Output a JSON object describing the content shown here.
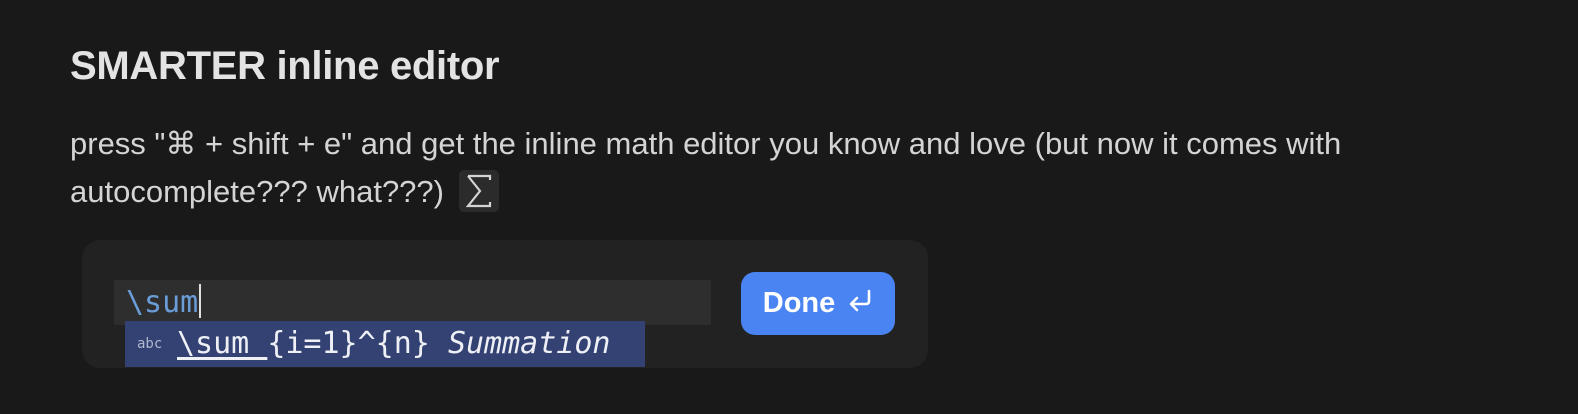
{
  "heading": "SMARTER inline editor",
  "description": "press \"⌘ + shift + e\" and get the inline math editor you know and love (but now it comes with autocomplete??? what???)",
  "description_icon": "sigma-icon",
  "editor": {
    "input_value": "\\sum",
    "suggestion": {
      "kind": "abc",
      "match": "\\sum_",
      "rest": "{i=1}^{n}",
      "description": "Summation"
    },
    "done_label": "Done",
    "done_icon": "enter-return-icon"
  },
  "colors": {
    "background": "#191919",
    "accent": "#4a84f2",
    "suggestion_highlight": "#334273",
    "input_text": "#6a9dd8"
  }
}
